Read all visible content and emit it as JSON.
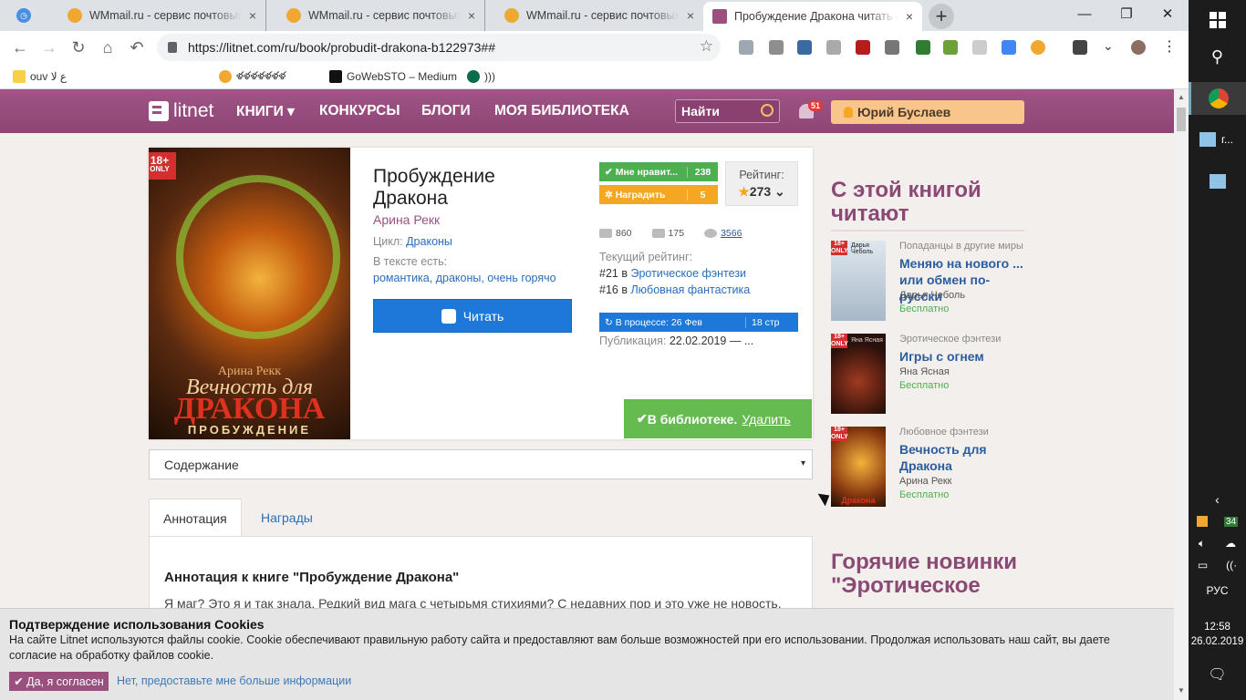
{
  "browser": {
    "tabs": [
      {
        "title": "WMmail.ru - сервис почтовых р",
        "close": "×"
      },
      {
        "title": "WMmail.ru - сервис почтовых р",
        "close": "×"
      },
      {
        "title": "WMmail.ru - сервис почтовых р",
        "close": "×"
      },
      {
        "title": "Пробуждение Дракона читать к",
        "close": "×"
      }
    ],
    "new_tab": "+",
    "url": "https://litnet.com/ru/book/probudit-drakona-b122973##",
    "bookmarks": [
      {
        "label": "ou‭v‬ ع لا"
      },
      {
        "label": ""
      },
      {
        "label": "ళళళళళళళ"
      },
      {
        "label": "GoWebSTO – Medium"
      },
      {
        "label": ")))"
      }
    ]
  },
  "nav": {
    "logo": "litnet",
    "items": [
      "КНИГИ",
      "КОНКУРСЫ",
      "БЛОГИ",
      "МОЯ БИБЛИОТЕКА"
    ],
    "books_caret": "▾",
    "search_placeholder": "Найти",
    "notif_count": "51",
    "user": "Юрий Буслаев"
  },
  "book": {
    "title": "Пробуждение Дракона",
    "author": "Арина Рекк",
    "cycle_label": "Цикл:",
    "cycle": "Драконы",
    "tags_label": "В тексте есть:",
    "tags": "романтика, драконы, очень горячо",
    "read_button": "Читать",
    "cover": {
      "author": "Арина Рекк",
      "line1": "Вечность для",
      "line2": "ДРАКОНА",
      "line3": "ПРОБУЖДЕНИЕ",
      "age": "18+",
      "age_only": "ONLY"
    },
    "likes_label": "Мне нравит...",
    "likes_count": "238",
    "reward_label": "Наградить",
    "reward_count": "5",
    "rating_label": "Рейтинг:",
    "rating_value": "273",
    "stat_library": "860",
    "stat_comments": "175",
    "stat_views": "3566",
    "current_rating_label": "Текущий рейтинг:",
    "ranks": [
      {
        "pos": "#21 в",
        "genre": "Эротическое фэнтези"
      },
      {
        "pos": "#16 в",
        "genre": "Любовная фантастика"
      }
    ],
    "status": "В процессе: 26 Фев",
    "pages": "18 стр",
    "pub_label": "Публикация:",
    "pub_date": "22.02.2019 — ...",
    "library_label": "В библиотеке.",
    "library_remove": "Удалить"
  },
  "contents": {
    "label": "Содержание",
    "caret": "▾"
  },
  "panel": {
    "tabs": [
      "Аннотация",
      "Награды"
    ],
    "heading": "Аннотация к книге \"Пробуждение Дракона\"",
    "text": "Я маг? Это я и так знала. Редкий вид мага с четырьмя стихиями? С недавних пор и это уже не новость."
  },
  "sidebar": {
    "heading1": "С этой книгой читают",
    "books": [
      {
        "category": "Попаданцы в другие миры",
        "title": "Меняю на нового ... или обмен по-русски",
        "author": "Дарья Чеболь",
        "price": "Бесплатно",
        "cover_author": "Дарья Чеболь"
      },
      {
        "category": "Эротическое фэнтези",
        "title": "Игры с огнем",
        "author": "Яна Ясная",
        "price": "Бесплатно",
        "cover_author": "Яна Ясная"
      },
      {
        "category": "Любовное фэнтези",
        "title": "Вечность для Дракона",
        "author": "Арина Рекк",
        "price": "Бесплатно",
        "cover_author": "Дракона"
      }
    ],
    "heading2": "Горячие новинки \"Эротическое"
  },
  "cookie": {
    "title": "Подтверждение использования Cookies",
    "text": "На сайте Litnet используются файлы cookie. Cookie обеспечивают правильную работу сайта и предоставляют вам больше возможностей при его использовании. Продолжая использовать наш сайт, вы даете согласие на обработку файлов cookie.",
    "agree": "Да, я согласен",
    "more": "Нет, предоставьте мне больше информации"
  },
  "taskbar": {
    "time": "12:58",
    "date": "26.02.2019",
    "lang": "РУС",
    "badge": "34",
    "pinned_label": "г..."
  }
}
